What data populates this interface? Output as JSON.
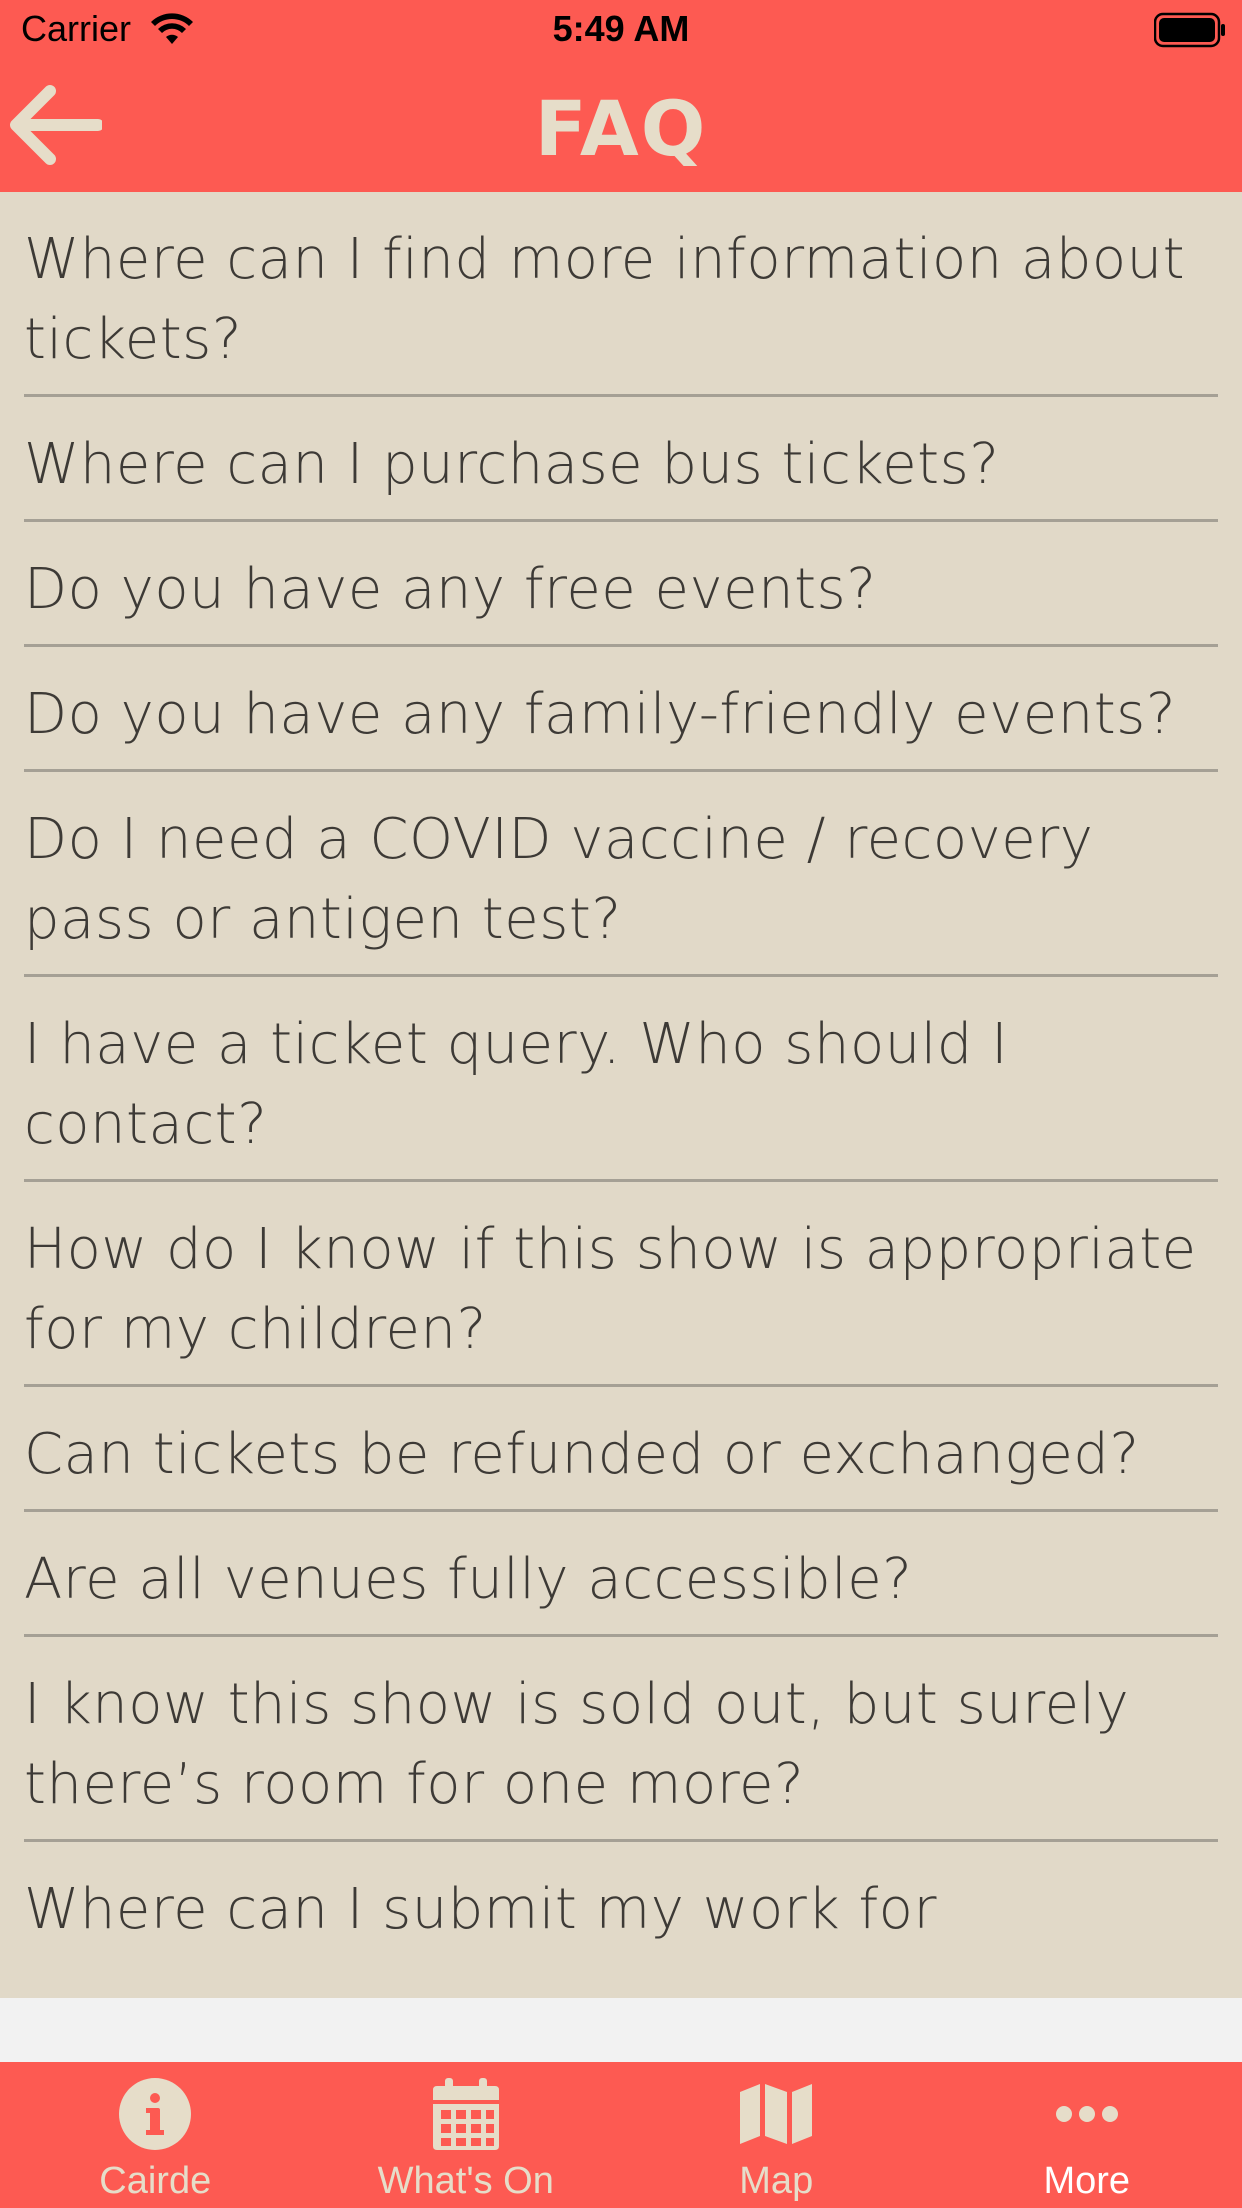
{
  "status_bar": {
    "carrier": "Carrier",
    "time": "5:49 AM"
  },
  "nav": {
    "title": "FAQ",
    "back_icon": "arrow-left-icon"
  },
  "faq": {
    "items": [
      "Where can I find more information about tickets?",
      "Where can I purchase bus tickets?",
      "Do you have any free events?",
      "Do you have any family-friendly events?",
      "Do I need a COVID vaccine / recovery pass or antigen test?",
      "I have a ticket query. Who should I contact?",
      "How do I know if this show is appropriate for my children?",
      "Can tickets be refunded or exchanged?",
      "Are all venues fully accessible?",
      "I know this show is sold out, but surely there’s room for one more?",
      "Where can I submit my work for"
    ]
  },
  "tab_bar": {
    "tabs": [
      {
        "label": "Cairde",
        "icon": "info-circle-icon"
      },
      {
        "label": "What's On",
        "icon": "calendar-icon"
      },
      {
        "label": "Map",
        "icon": "map-icon"
      },
      {
        "label": "More",
        "icon": "more-dots-icon"
      }
    ],
    "active": "More"
  },
  "colors": {
    "accent": "#fd5a52",
    "background": "#e1d9c8",
    "header_text": "#e6ddc9",
    "body_text": "#3d3a36"
  }
}
